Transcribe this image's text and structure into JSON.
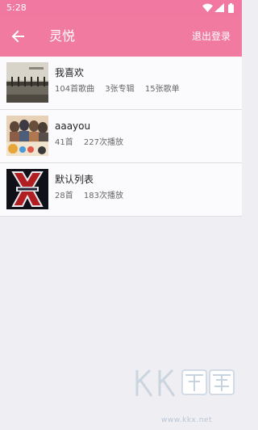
{
  "status_bar": {
    "time": "5:28",
    "icons": [
      "wifi-icon",
      "signal-icon",
      "battery-icon"
    ]
  },
  "app_bar": {
    "title": "灵悦",
    "logout_label": "退出登录",
    "back_icon": "arrow-left-icon",
    "color": "#f17aa1"
  },
  "playlists": [
    {
      "title": "我喜欢",
      "meta": [
        "104首歌曲",
        "3张专辑",
        "15张歌单"
      ],
      "cover": "pier-album-cover"
    },
    {
      "title": "aaayou",
      "meta": [
        "41首",
        "227次播放"
      ],
      "cover": "band-album-cover"
    },
    {
      "title": "默认列表",
      "meta": [
        "28首",
        "183次播放"
      ],
      "cover": "x-factor-album-cover"
    }
  ],
  "watermark": {
    "logo": "kkx-logo",
    "url": "www.kkx.net"
  }
}
